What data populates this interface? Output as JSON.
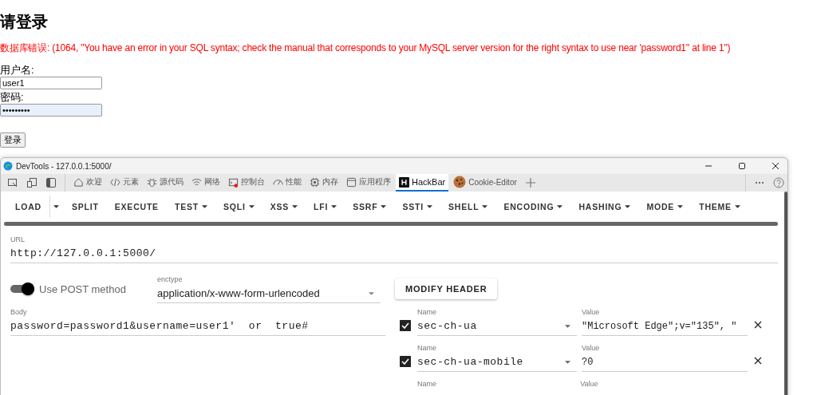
{
  "page": {
    "heading": "请登录",
    "error": "数据库错误: (1064, \"You have an error in your SQL syntax; check the manual that corresponds to your MySQL server version for the right syntax to use near 'password1'' at line 1\")",
    "username_label": "用户名:",
    "username_value": "user1",
    "password_label": "密码:",
    "password_value": "•••••••••",
    "submit": "登录"
  },
  "devtools": {
    "title": "DevTools - 127.0.0.1:5000/",
    "tabs": [
      {
        "kind": "home",
        "label": "欢迎",
        "selected": false
      },
      {
        "kind": "code",
        "label": "元素",
        "selected": false
      },
      {
        "kind": "bug",
        "label": "源代码",
        "selected": false
      },
      {
        "kind": "wifi",
        "label": "网络",
        "selected": false
      },
      {
        "kind": "console",
        "label": "控制台",
        "selected": false
      },
      {
        "kind": "gauge",
        "label": "性能",
        "selected": false
      },
      {
        "kind": "chip",
        "label": "内存",
        "selected": false
      },
      {
        "kind": "window",
        "label": "应用程序",
        "selected": false
      },
      {
        "kind": "hackbar",
        "label": "HackBar",
        "selected": true
      },
      {
        "kind": "cookie",
        "label": "Cookie-Editor",
        "selected": false
      }
    ],
    "hackbar": {
      "menu": [
        {
          "kind": "split",
          "label": "LOAD"
        },
        {
          "kind": "plain",
          "label": "SPLIT"
        },
        {
          "kind": "plain",
          "label": "EXECUTE"
        },
        {
          "kind": "dropdown",
          "label": "TEST"
        },
        {
          "kind": "dropdown",
          "label": "SQLI"
        },
        {
          "kind": "dropdown",
          "label": "XSS"
        },
        {
          "kind": "dropdown",
          "label": "LFI"
        },
        {
          "kind": "dropdown",
          "label": "SSRF"
        },
        {
          "kind": "dropdown",
          "label": "SSTI"
        },
        {
          "kind": "dropdown",
          "label": "SHELL"
        },
        {
          "kind": "dropdown",
          "label": "ENCODING"
        },
        {
          "kind": "dropdown",
          "label": "HASHING"
        },
        {
          "kind": "dropdown",
          "label": "MODE"
        },
        {
          "kind": "dropdown",
          "label": "THEME"
        }
      ],
      "url_label": "URL",
      "url": "http://127.0.0.1:5000/",
      "post": {
        "on": true,
        "label": "Use POST method"
      },
      "enctype_label": "enctype",
      "enctype": "application/x-www-form-urlencoded",
      "modify_header": "MODIFY HEADER",
      "body_label": "Body",
      "body": "password=password1&username=user1'  or  true#",
      "headers": [
        {
          "checked": true,
          "name_label": "Name",
          "name": "sec-ch-ua",
          "value_label": "Value",
          "value": "\"Microsoft Edge\";v=\"135\", \""
        },
        {
          "checked": true,
          "name_label": "Name",
          "name": "sec-ch-ua-mobile",
          "value_label": "Value",
          "value": "?0"
        },
        {
          "name_label": "Name",
          "value_label": "Value"
        }
      ]
    }
  }
}
